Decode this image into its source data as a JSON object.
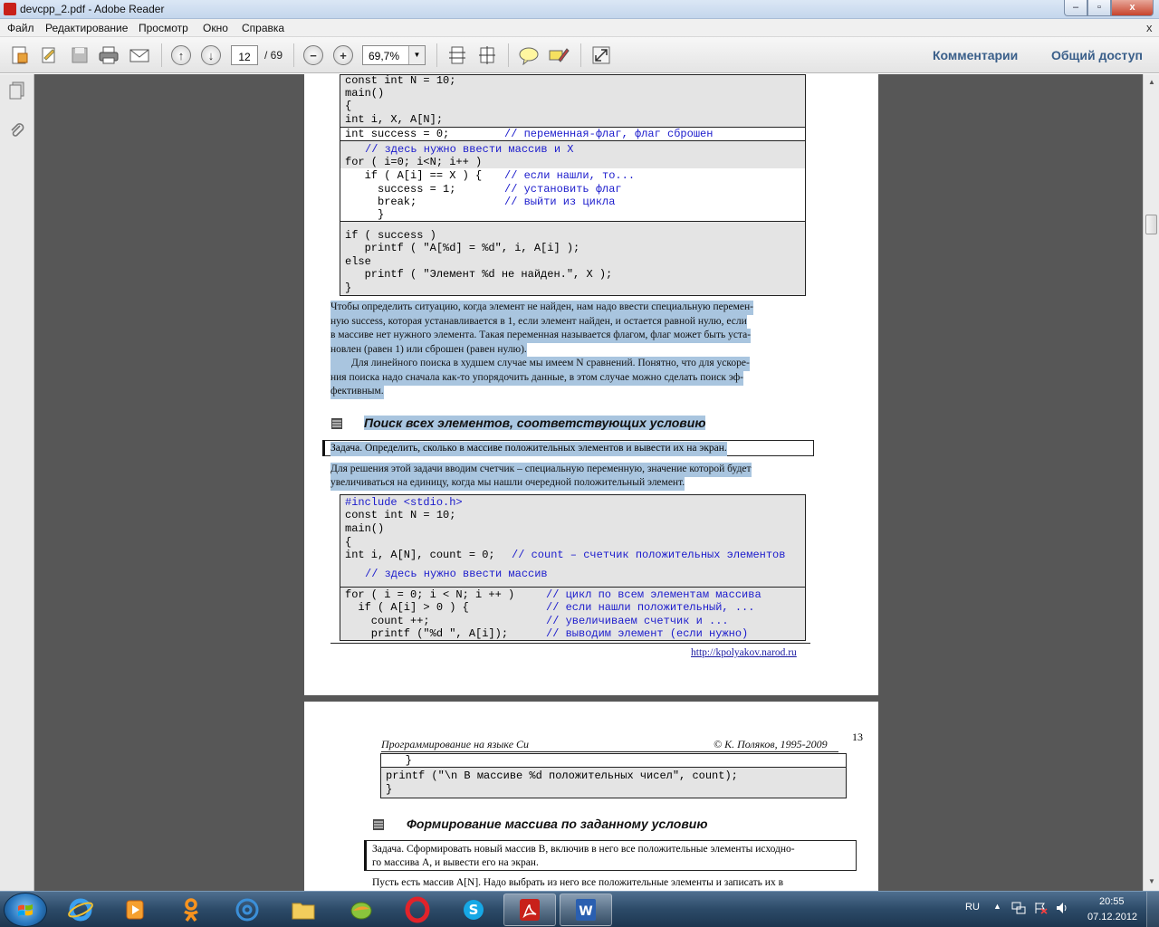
{
  "window": {
    "title": "devcpp_2.pdf - Adobe Reader",
    "min_label": "–",
    "max_label": "▫",
    "close_label": "x"
  },
  "menu": {
    "items": [
      "Файл",
      "Редактирование",
      "Просмотр",
      "Окно",
      "Справка"
    ],
    "close_label": "x"
  },
  "toolbar": {
    "page_current": "12",
    "page_total": "/ 69",
    "zoom": "69,7%",
    "comments_label": "Комментарии",
    "share_label": "Общий доступ",
    "icons": [
      "create-pdf-icon",
      "edit-icon",
      "save-icon",
      "print-icon",
      "email-icon",
      "prev-page-icon",
      "next-page-icon",
      "zoom-out-icon",
      "zoom-in-icon",
      "fit-page-icon",
      "fit-width-icon",
      "comment-icon",
      "highlight-icon",
      "fullscreen-icon"
    ]
  },
  "page1": {
    "code1": [
      "const int N = 10;",
      "main()",
      "{",
      "int i, X, A[N];"
    ],
    "code1_flag": "int success = 0;",
    "code1_flag_comment": "// переменная-флаг, флаг сброшен",
    "code1_input_comment": "// здесь нужно ввести массив и X",
    "code1_loop": [
      "for ( i=0; i<N; i++ )",
      "   if ( A[i] == X ) {",
      "     success = 1;",
      "     break;",
      "     }"
    ],
    "code1_loop_comments": [
      "// если нашли, то...",
      "// установить флаг",
      "// выйти из цикла"
    ],
    "code1_result": [
      "if ( success )",
      "   printf ( \"A[%d] = %d\", i, A[i] );",
      "else",
      "   printf ( \"Элемент %d не найден.\", X );",
      "}"
    ],
    "para1": [
      "Чтобы определить ситуацию, когда элемент не найден, нам надо ввести специальную перемен-",
      "ную success, которая устанавливается в 1, если элемент найден, и остается равной нулю, если",
      "в массиве нет нужного элемента. Такая переменная называется флагом, флаг может быть уста-",
      "новлен (равен 1) или сброшен (равен нулю)."
    ],
    "para2": [
      "        Для линейного поиска в худшем случае мы имеем N сравнений. Понятно, что для ускоре-",
      "ния поиска надо сначала как-то упорядочить данные, в этом случае можно сделать поиск эф-",
      "фективным."
    ],
    "heading": "Поиск всех элементов, соответствующих условию",
    "task": "Задача. Определить, сколько в массиве положительных элементов и вывести их на экран.",
    "para3": [
      "Для решения этой задачи вводим счетчик – специальную переменную, значение которой будет",
      "увеличиваться на единицу, когда мы нашли очередной положительный элемент."
    ],
    "code2": [
      "#include <stdio.h>",
      "const int N = 10;",
      "main()",
      "{",
      "int i, A[N], count = 0;"
    ],
    "code2_count_comment": "// count – счетчик положительных элементов",
    "code2_input_comment": "// здесь нужно ввести массив",
    "code2_loop": [
      "for ( i = 0; i < N; i ++ )",
      "  if ( A[i] > 0 ) {",
      "    count ++;",
      "    printf (\"%d \", A[i]);"
    ],
    "code2_loop_comments": [
      "// цикл по всем элементам массива",
      "// если нашли положительный, ...",
      "// увеличиваем счетчик и ...",
      "// выводим элемент (если нужно)"
    ],
    "footer_link": "http://kpolyakov.narod.ru"
  },
  "page2": {
    "header_left": "Программирование на языке Си",
    "header_right": "© К. Поляков, 1995-2009",
    "page_number": "13",
    "code": [
      "   }",
      "printf (\"\\n В массиве %d положительных чисел\", count);",
      "}"
    ],
    "heading": "Формирование массива по заданному условию",
    "task": [
      "Задача. Сформировать новый массив B, включив в него все положительные элементы исходно-",
      "го массива A, и вывести его на экран."
    ],
    "para": "Пусть есть массив A[N]. Надо выбрать из него все положительные элементы и записать их в"
  },
  "taskbar": {
    "apps": [
      "ie-icon",
      "media-player-icon",
      "odnoklassniki-icon",
      "email-app-icon",
      "folder-icon",
      "fruit-app-icon",
      "opera-icon",
      "skype-icon",
      "adobe-reader-icon",
      "word-icon"
    ],
    "language": "RU",
    "time": "20:55",
    "date": "07.12.2012"
  }
}
